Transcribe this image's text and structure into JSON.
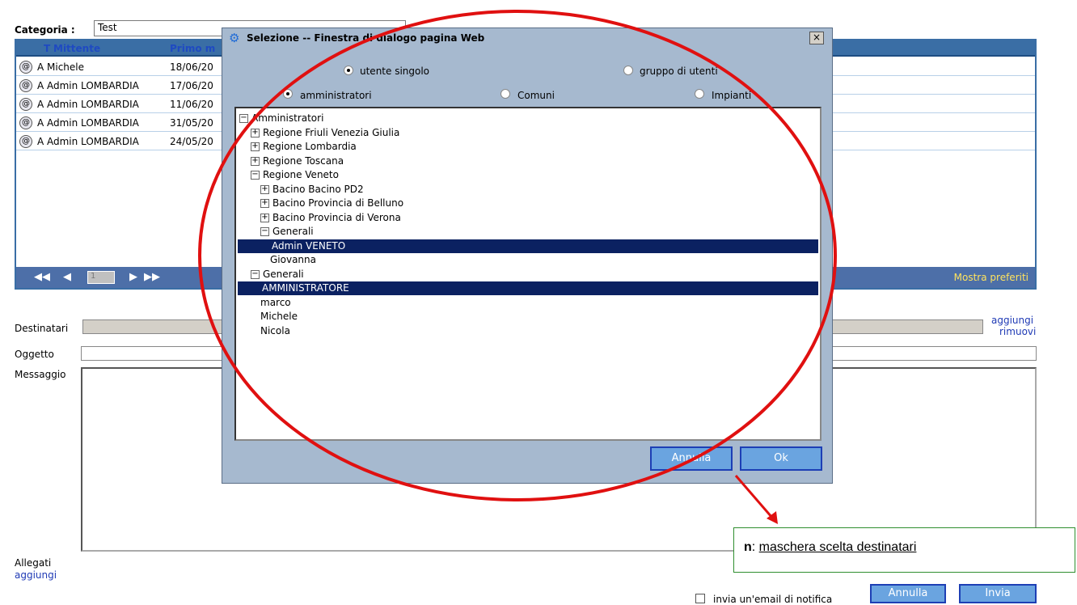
{
  "page": {
    "categoria_label": "Categoria :",
    "categoria_value": "Test",
    "table": {
      "headers": [
        "T",
        "Mittente",
        "Primo m"
      ],
      "rows": [
        {
          "type": "A",
          "sender": "Michele",
          "date": "18/06/20"
        },
        {
          "type": "A",
          "sender": "Admin LOMBARDIA",
          "date": "17/06/20"
        },
        {
          "type": "A",
          "sender": "Admin LOMBARDIA",
          "date": "11/06/20"
        },
        {
          "type": "A",
          "sender": "Admin LOMBARDIA",
          "date": "31/05/20"
        },
        {
          "type": "A",
          "sender": "Admin LOMBARDIA",
          "date": "24/05/20"
        }
      ],
      "page_number": "1",
      "show_favorites": "Mostra preferiti"
    },
    "form": {
      "destinatari_label": "Destinatari",
      "add_link": "aggiungi",
      "remove_link": "rimuovi",
      "oggetto_label": "Oggetto",
      "messaggio_label": "Messaggio",
      "allegati_label": "Allegati",
      "allegati_add_link": "aggiungi",
      "email_notify_label": "invia un'email di notifica",
      "cancel_button": "Annulla",
      "send_button": "Invia"
    }
  },
  "dialog": {
    "title": "Selezione -- Finestra di dialogo pagina Web",
    "close_glyph": "×",
    "radio_row1": [
      {
        "label": "utente singolo",
        "selected": true
      },
      {
        "label": "gruppo di utenti",
        "selected": false
      }
    ],
    "radio_row2": [
      {
        "label": "amministratori",
        "selected": true
      },
      {
        "label": "Comuni",
        "selected": false
      },
      {
        "label": "Impianti",
        "selected": false
      }
    ],
    "tree": [
      {
        "label": "Amministratori",
        "toggle": "−",
        "level": 0
      },
      {
        "label": "Regione Friuli Venezia Giulia",
        "toggle": "+",
        "level": 1
      },
      {
        "label": "Regione Lombardia",
        "toggle": "+",
        "level": 1
      },
      {
        "label": "Regione Toscana",
        "toggle": "+",
        "level": 1
      },
      {
        "label": "Regione Veneto",
        "toggle": "−",
        "level": 1
      },
      {
        "label": "Bacino Bacino PD2",
        "toggle": "+",
        "level": 2
      },
      {
        "label": "Bacino Provincia di Belluno",
        "toggle": "+",
        "level": 2
      },
      {
        "label": "Bacino Provincia di Verona",
        "toggle": "+",
        "level": 2
      },
      {
        "label": "Generali",
        "toggle": "−",
        "level": 2
      },
      {
        "label": "Admin VENETO",
        "toggle": "",
        "level": 3,
        "selected": true
      },
      {
        "label": "Giovanna",
        "toggle": "",
        "level": 3
      },
      {
        "label": "Generali",
        "toggle": "−",
        "level": 1
      },
      {
        "label": "AMMINISTRATORE",
        "toggle": "",
        "level": 2,
        "selected": true
      },
      {
        "label": "marco",
        "toggle": "",
        "level": 2
      },
      {
        "label": "Michele",
        "toggle": "",
        "level": 2
      },
      {
        "label": "Nicola",
        "toggle": "",
        "level": 2
      }
    ],
    "cancel_button": "Annulla",
    "ok_button": "Ok"
  },
  "annotation": {
    "prefix": "n",
    "separator": ": ",
    "text": "maschera scelta destinatari",
    "color_ellipse": "#e01010",
    "color_arrow": "#e01010"
  }
}
